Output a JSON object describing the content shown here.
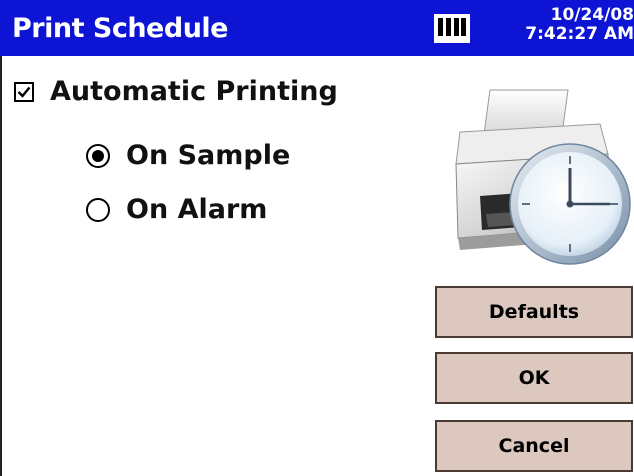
{
  "window": {
    "title": "Print Schedule",
    "date": "10/24/08",
    "time": "7:42:27 AM",
    "battery_icon": "battery-icon"
  },
  "form": {
    "automatic_printing": {
      "label": "Automatic Printing",
      "checked": true
    },
    "trigger_options": [
      {
        "label": "On Sample",
        "selected": true
      },
      {
        "label": "On Alarm",
        "selected": false
      }
    ]
  },
  "illustration": {
    "icon": "printer-clock-icon"
  },
  "buttons": {
    "defaults": "Defaults",
    "ok": "OK",
    "cancel": "Cancel"
  },
  "colors": {
    "title_bar": "#0d14d4",
    "title_text": "#ffffff",
    "button_face": "#ddc8c0"
  }
}
